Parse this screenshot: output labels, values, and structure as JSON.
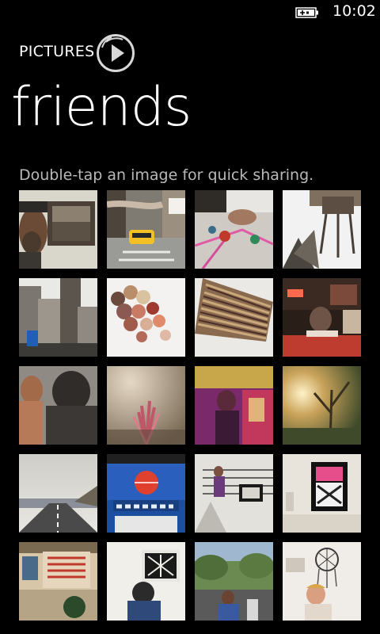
{
  "status_bar": {
    "time": "10:02",
    "battery_icon": "battery-charging-icon"
  },
  "header": {
    "section_label": "PICTURES",
    "play_icon": "play-slideshow-icon",
    "title": "friends",
    "hint": "Double-tap an image for quick sharing."
  },
  "thumbnails": [
    {
      "subject": "bearded man beside framed photo"
    },
    {
      "subject": "city street with yellow taxi"
    },
    {
      "subject": "hands playing with balls on pavement"
    },
    {
      "subject": "rooftop water tower"
    },
    {
      "subject": "city skyline with person in blue"
    },
    {
      "subject": "pile of colorful buttons"
    },
    {
      "subject": "striped fabric swatches"
    },
    {
      "subject": "diner interior with neon sign"
    },
    {
      "subject": "two people talking"
    },
    {
      "subject": "plant in hazy light"
    },
    {
      "subject": "woman in purple lit kitchen"
    },
    {
      "subject": "sunlight through trees"
    },
    {
      "subject": "coastal highway under sky"
    },
    {
      "subject": "red ball on blue storefront"
    },
    {
      "subject": "woman on staircase"
    },
    {
      "subject": "gallery wall with poster"
    },
    {
      "subject": "cafe menu board"
    },
    {
      "subject": "man looking at framed art"
    },
    {
      "subject": "crowd taking photos outdoors"
    },
    {
      "subject": "woman under dreamcatcher"
    }
  ]
}
